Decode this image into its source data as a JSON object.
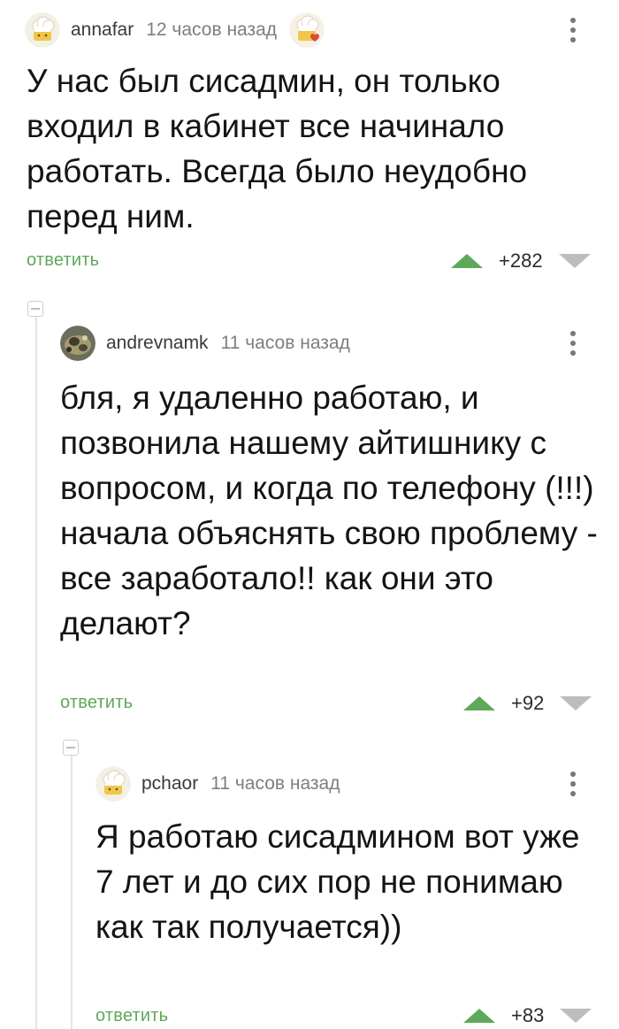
{
  "comments": [
    {
      "username": "annafar",
      "time": "12 часов назад",
      "text": "У нас был сисадмин, он только входил в кабинет все начинало работать. Всегда было неудобно перед ним.",
      "reply_label": "ответить",
      "score": "+282",
      "avatar_icon": "default-chef-avatar-icon",
      "badge_icon": "chef-heart-badge-icon"
    },
    {
      "username": "andrevnamk",
      "time": "11 часов назад",
      "text": "бля, я удаленно работаю, и позвонила нашему айтишнику с вопросом, и когда по телефону (!!!) начала объяснять свою проблему - все заработало!! как они это делают?",
      "reply_label": "ответить",
      "score": "+92",
      "avatar_icon": "photo-avatar-icon"
    },
    {
      "username": "pchaor",
      "time": "11 часов назад",
      "text": "Я работаю сисадмином вот уже 7 лет и до сих пор не понимаю как так получается))",
      "reply_label": "ответить",
      "score": "+83",
      "avatar_icon": "default-chef-avatar-icon"
    }
  ],
  "colors": {
    "accent_green": "#5fa85a",
    "downvote_gray": "#bdbdbd",
    "thread_line": "#e4e4e4"
  }
}
